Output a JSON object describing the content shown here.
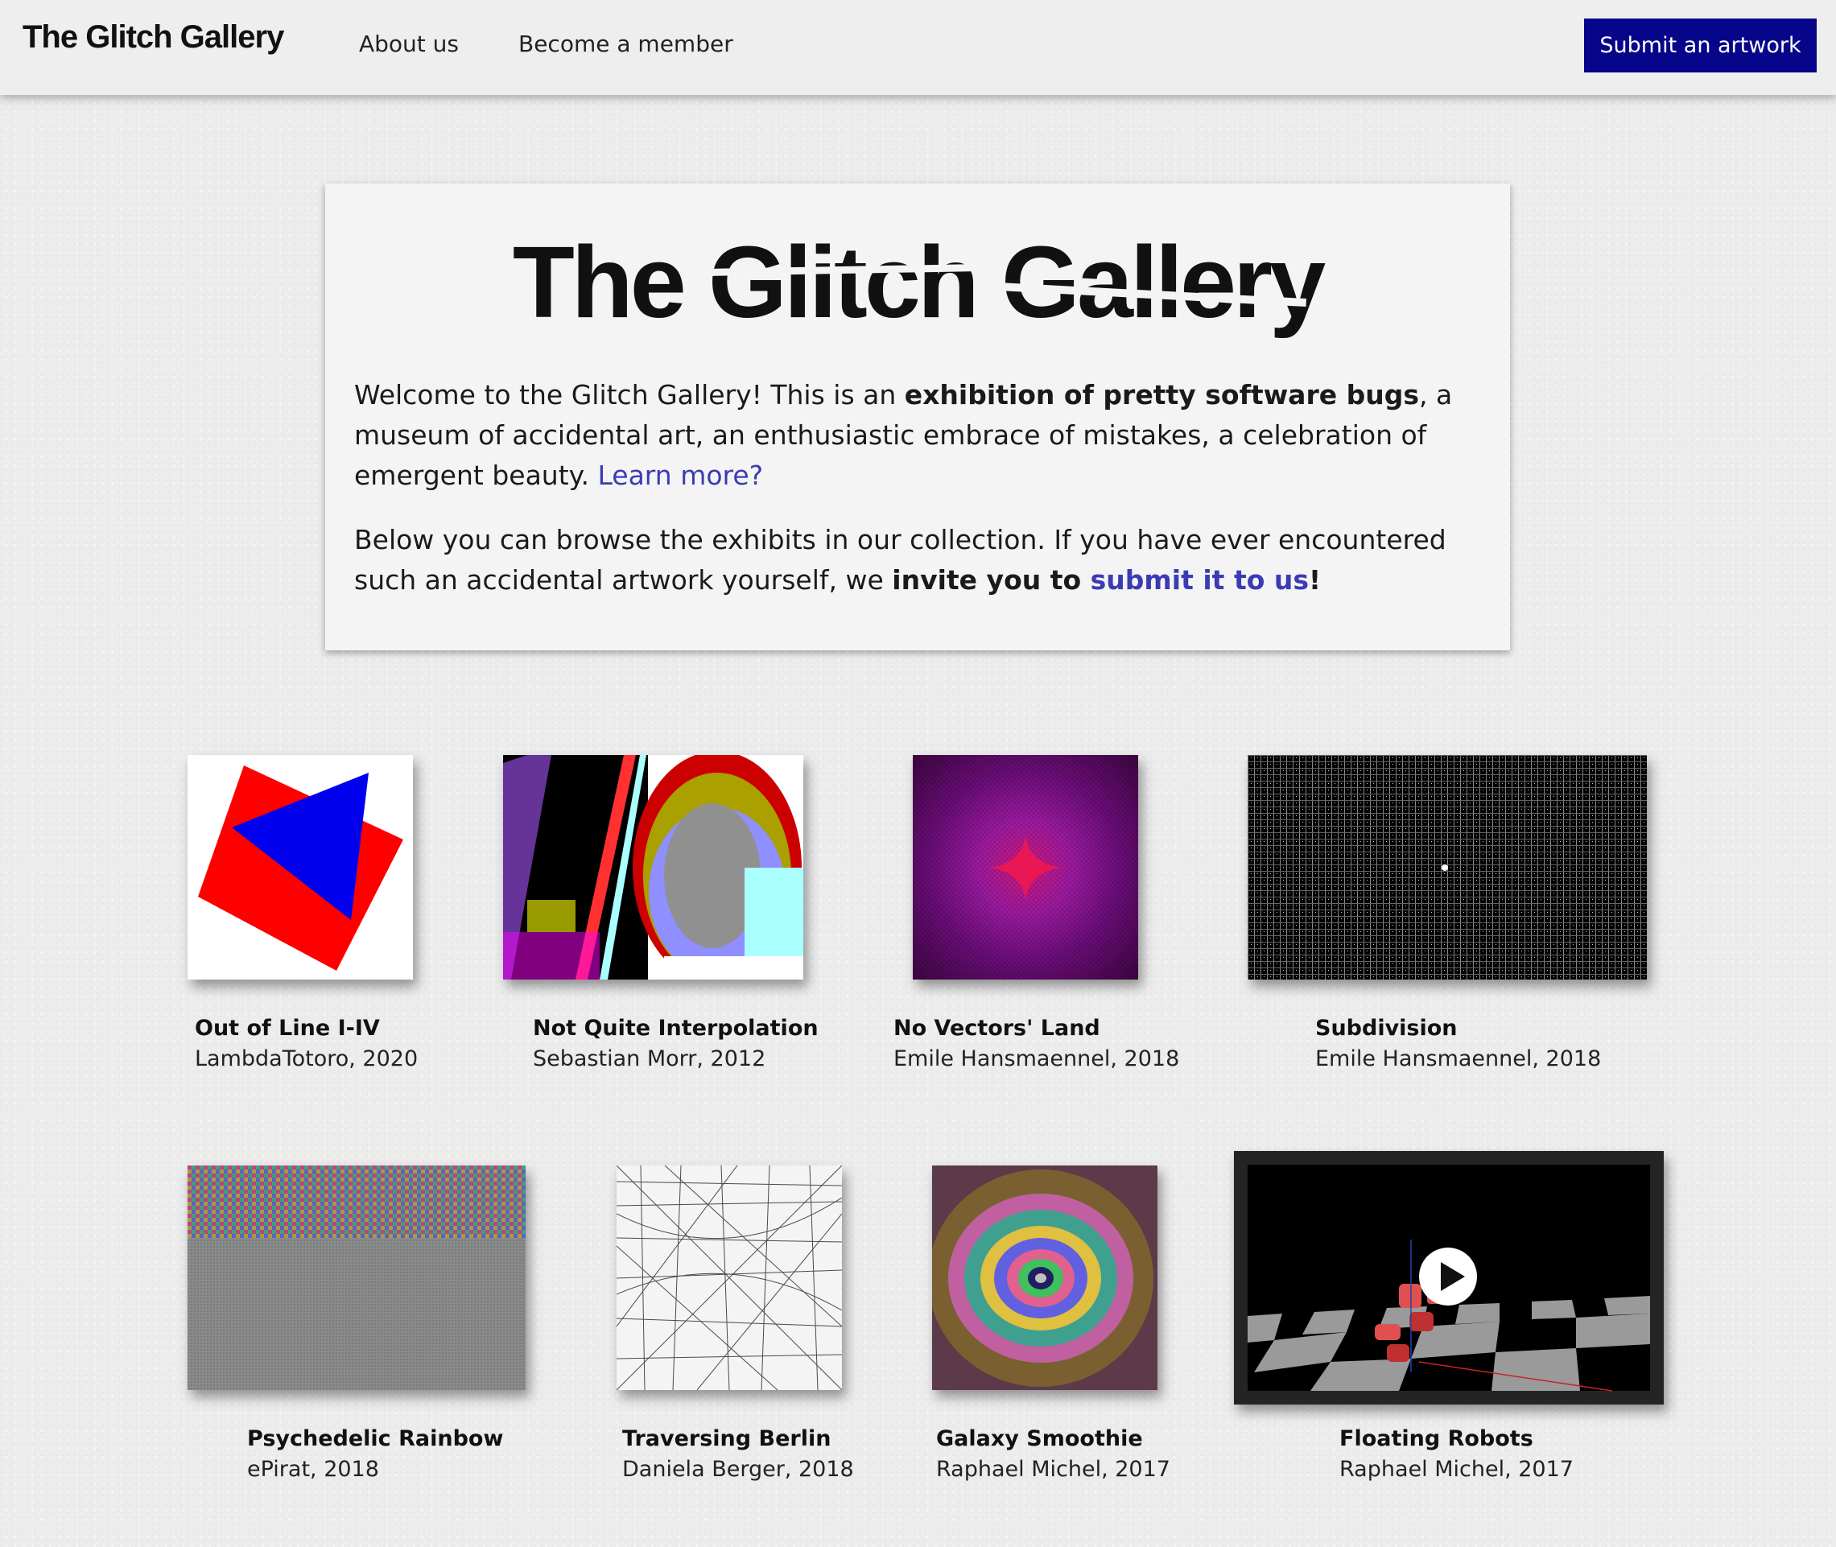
{
  "nav": {
    "logo": "The Glitch Gallery",
    "about": "About us",
    "member": "Become a member",
    "submit": "Submit an artwork"
  },
  "intro": {
    "title_the": "The",
    "title_glitch": "Glitch",
    "title_gallery": "Gallery",
    "p1_a": "Welcome to the Glitch Gallery! This is an ",
    "p1_b": "exhibition of pretty software bugs",
    "p1_c": ", a museum of accidental art, an enthusiastic embrace of mistakes, a celebration of emergent beauty. ",
    "p1_link": "Learn more?",
    "p2_a": "Below you can browse the exhibits in our collection. If you have ever encountered such an accidental artwork yourself, we ",
    "p2_b": "invite you to ",
    "p2_link": "submit it to us",
    "p2_c": "!"
  },
  "artworks": [
    {
      "title": "Out of Line I-IV",
      "meta": "LambdaTotoro, 2020"
    },
    {
      "title": "Not Quite Interpolation",
      "meta": "Sebastian Morr, 2012"
    },
    {
      "title": "No Vectors' Land",
      "meta": "Emile Hansmaennel, 2018"
    },
    {
      "title": "Subdivision",
      "meta": "Emile Hansmaennel, 2018"
    },
    {
      "title": "Psychedelic Rainbow",
      "meta": "ePirat, 2018"
    },
    {
      "title": "Traversing Berlin",
      "meta": "Daniela Berger, 2018"
    },
    {
      "title": "Galaxy Smoothie",
      "meta": "Raphael Michel, 2017"
    },
    {
      "title": "Floating Robots",
      "meta": "Raphael Michel, 2017"
    }
  ],
  "colors": {
    "accent": "#07068a",
    "link": "#3b3bb5",
    "background": "#ececec"
  },
  "icons": {
    "play": "play-icon"
  }
}
